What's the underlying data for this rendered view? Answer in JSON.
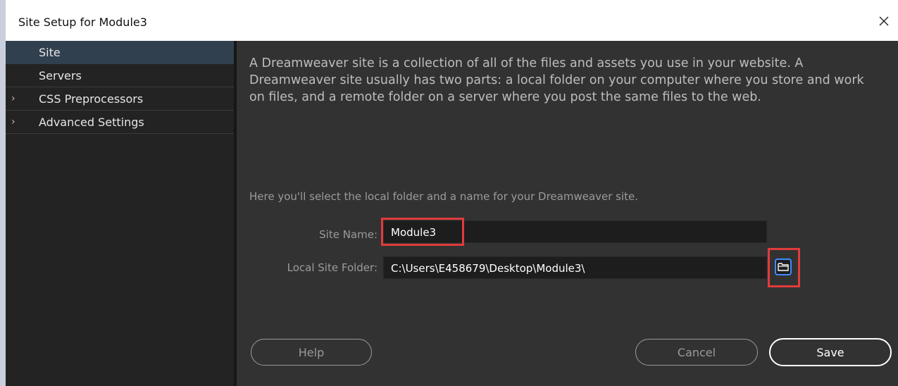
{
  "window": {
    "title": "Site Setup for Module3",
    "close_glyph": "✕"
  },
  "sidebar": {
    "items": [
      {
        "label": "Site",
        "active": true,
        "chevron": ""
      },
      {
        "label": "Servers",
        "active": false,
        "chevron": ""
      },
      {
        "label": "CSS Preprocessors",
        "active": false,
        "chevron": "›"
      },
      {
        "label": "Advanced Settings",
        "active": false,
        "chevron": "›"
      }
    ]
  },
  "main": {
    "description": "A Dreamweaver site is a collection of all of the files and assets you use in your website. A Dreamweaver site usually has two parts: a local folder on your computer where you store and work on files, and a remote folder on a server where you post the same files to the web.",
    "hint": "Here you'll select the local folder and a name for your Dreamweaver site.",
    "site_name_label": "Site Name:",
    "site_name_value": "Module3",
    "local_folder_label": "Local Site Folder:",
    "local_folder_value": "C:\\Users\\E458679\\Desktop\\Module3\\",
    "folder_icon": "folder-icon"
  },
  "buttons": {
    "help": "Help",
    "cancel": "Cancel",
    "save": "Save"
  },
  "colors": {
    "sidebar_bg": "#232323",
    "main_bg": "#323232",
    "active_item": "#31404f",
    "highlight": "#e23b3b",
    "folder_accent": "#3d8cff"
  }
}
